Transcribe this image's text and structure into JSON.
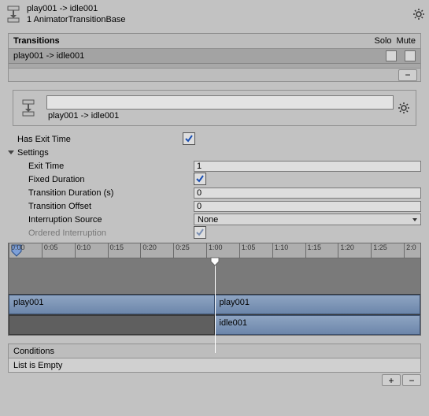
{
  "header": {
    "title": "play001 -> idle001",
    "subtitle": "1 AnimatorTransitionBase"
  },
  "transitions": {
    "title": "Transitions",
    "solo": "Solo",
    "mute": "Mute",
    "items": [
      {
        "label": "play001 -> idle001",
        "solo": false,
        "mute": false
      }
    ]
  },
  "selected": {
    "name": "play001 -> idle001"
  },
  "props": {
    "hasExitTime": {
      "label": "Has Exit Time",
      "value": true
    },
    "settings": {
      "label": "Settings",
      "open": true
    },
    "exitTime": {
      "label": "Exit Time",
      "value": "1"
    },
    "fixedDuration": {
      "label": "Fixed Duration",
      "value": true
    },
    "transitionDuration": {
      "label": "Transition Duration (s)",
      "value": "0"
    },
    "transitionOffset": {
      "label": "Transition Offset",
      "value": "0"
    },
    "interruptionSource": {
      "label": "Interruption Source",
      "value": "None"
    },
    "orderedInterruption": {
      "label": "Ordered Interruption",
      "value": true
    }
  },
  "timeline": {
    "ticks": [
      "0:00",
      "0:05",
      "0:10",
      "0:15",
      "0:20",
      "0:25",
      "1:00",
      "1:05",
      "1:10",
      "1:15",
      "1:20",
      "1:25",
      "2:0"
    ],
    "playhead": 0.5,
    "clips": {
      "srcA": "play001",
      "srcB": "play001",
      "dst": "idle001"
    }
  },
  "conditions": {
    "title": "Conditions",
    "empty": "List is Empty"
  }
}
